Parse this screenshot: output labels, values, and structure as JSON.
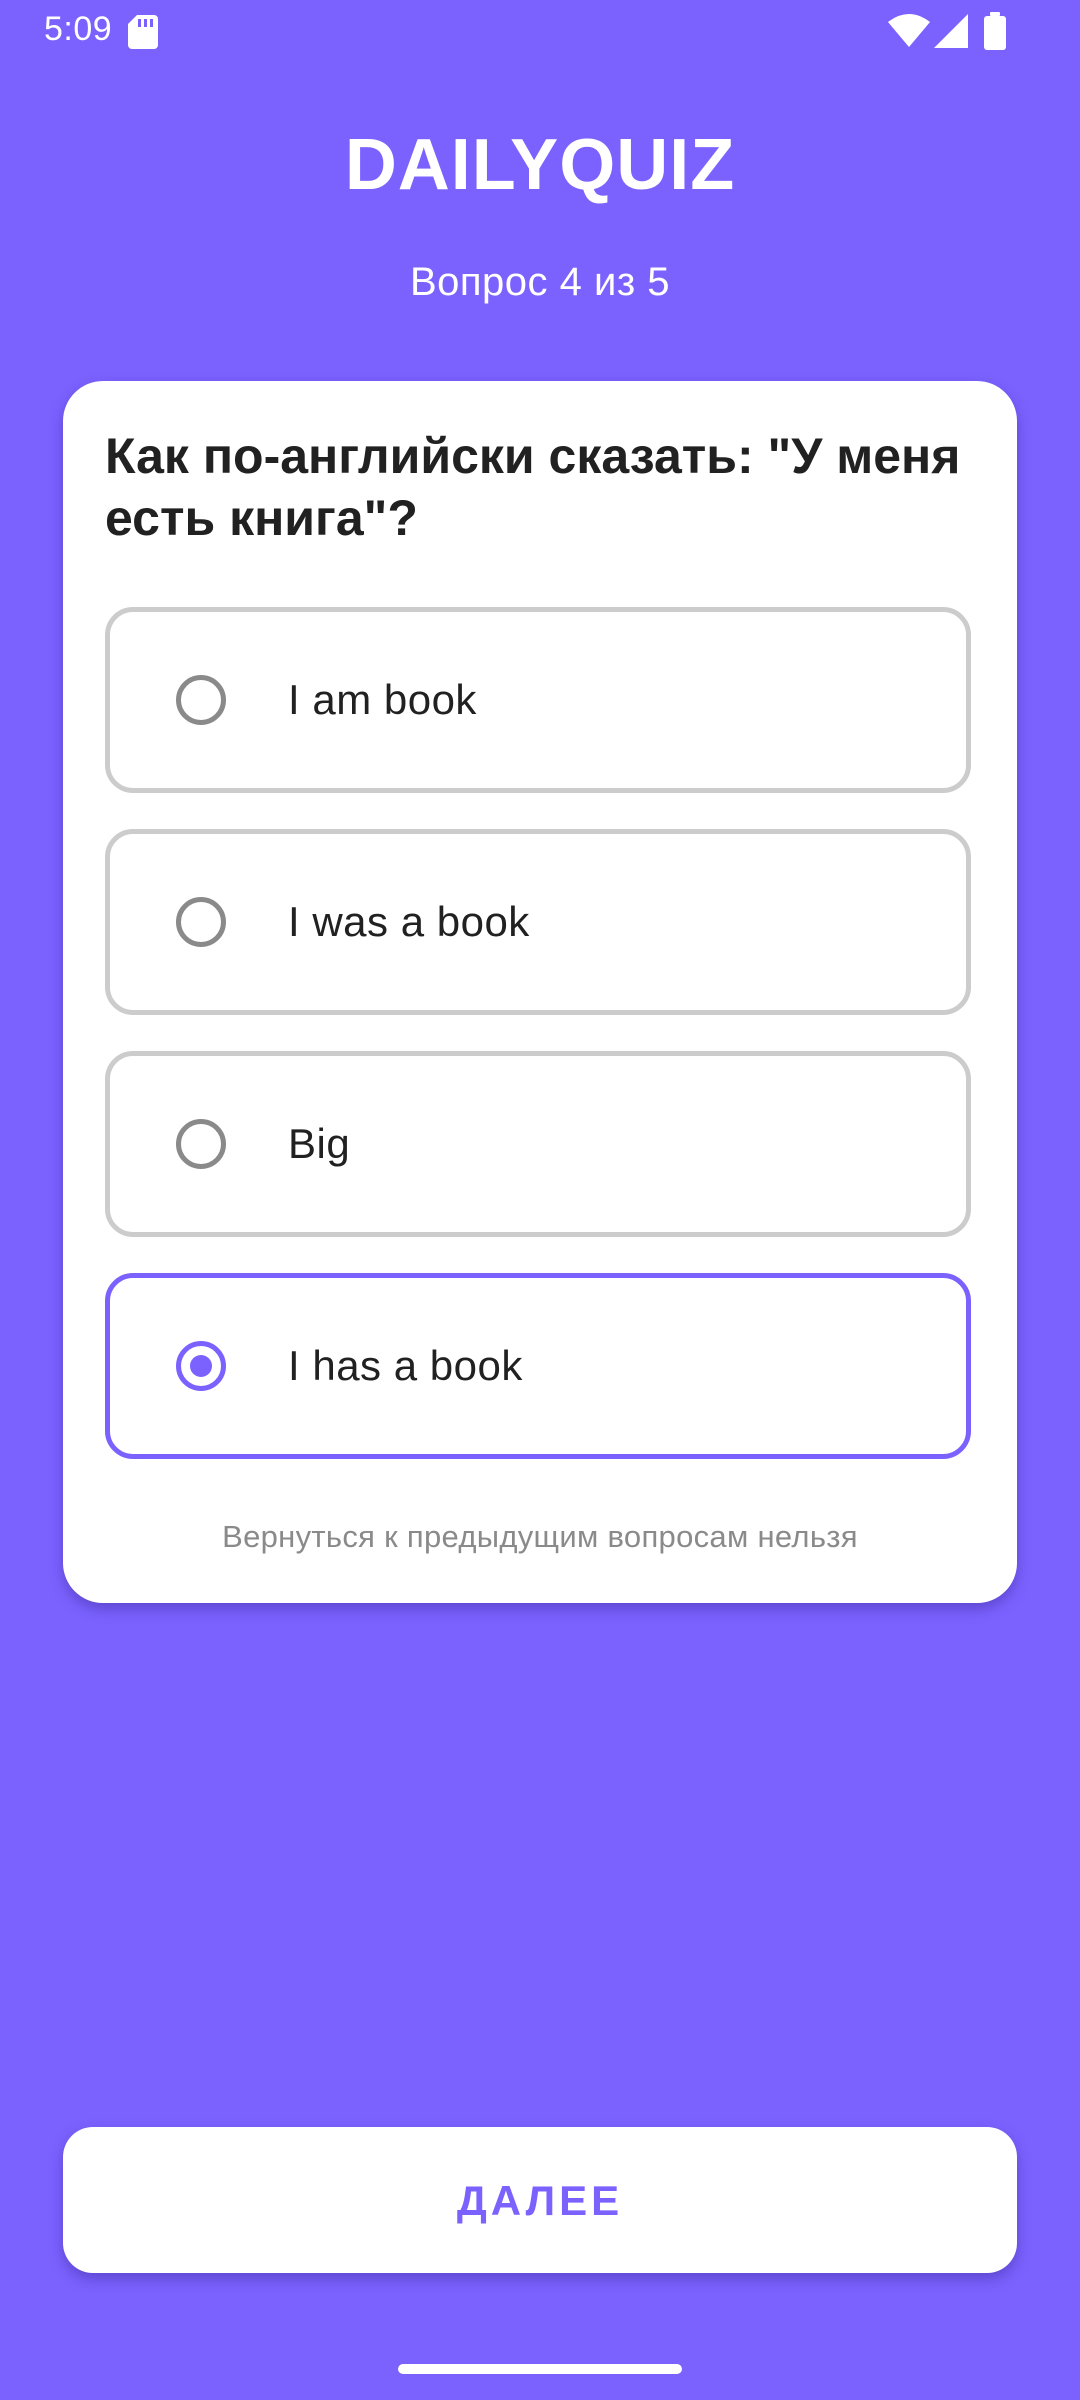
{
  "status_bar": {
    "time": "5:09",
    "icons": [
      "sd-card-icon",
      "wifi-icon",
      "signal-icon",
      "battery-icon"
    ]
  },
  "header": {
    "title": "DAILYQUIZ",
    "progress": "Вопрос 4 из 5"
  },
  "quiz": {
    "question": "Как по-английски сказать: \"У меня есть книга\"?",
    "options": [
      {
        "label": "I am book",
        "selected": false
      },
      {
        "label": "I was a book",
        "selected": false
      },
      {
        "label": "Big",
        "selected": false
      },
      {
        "label": "I has a book",
        "selected": true
      }
    ],
    "hint": "Вернуться к предыдущим вопросам нельзя"
  },
  "actions": {
    "next_label": "ДАЛЕЕ"
  },
  "colors": {
    "accent": "#7b62ff",
    "background": "#7b62ff",
    "card": "#ffffff",
    "option_border": "#cccccc",
    "text": "#212121",
    "hint_text": "#8a8a8a"
  }
}
